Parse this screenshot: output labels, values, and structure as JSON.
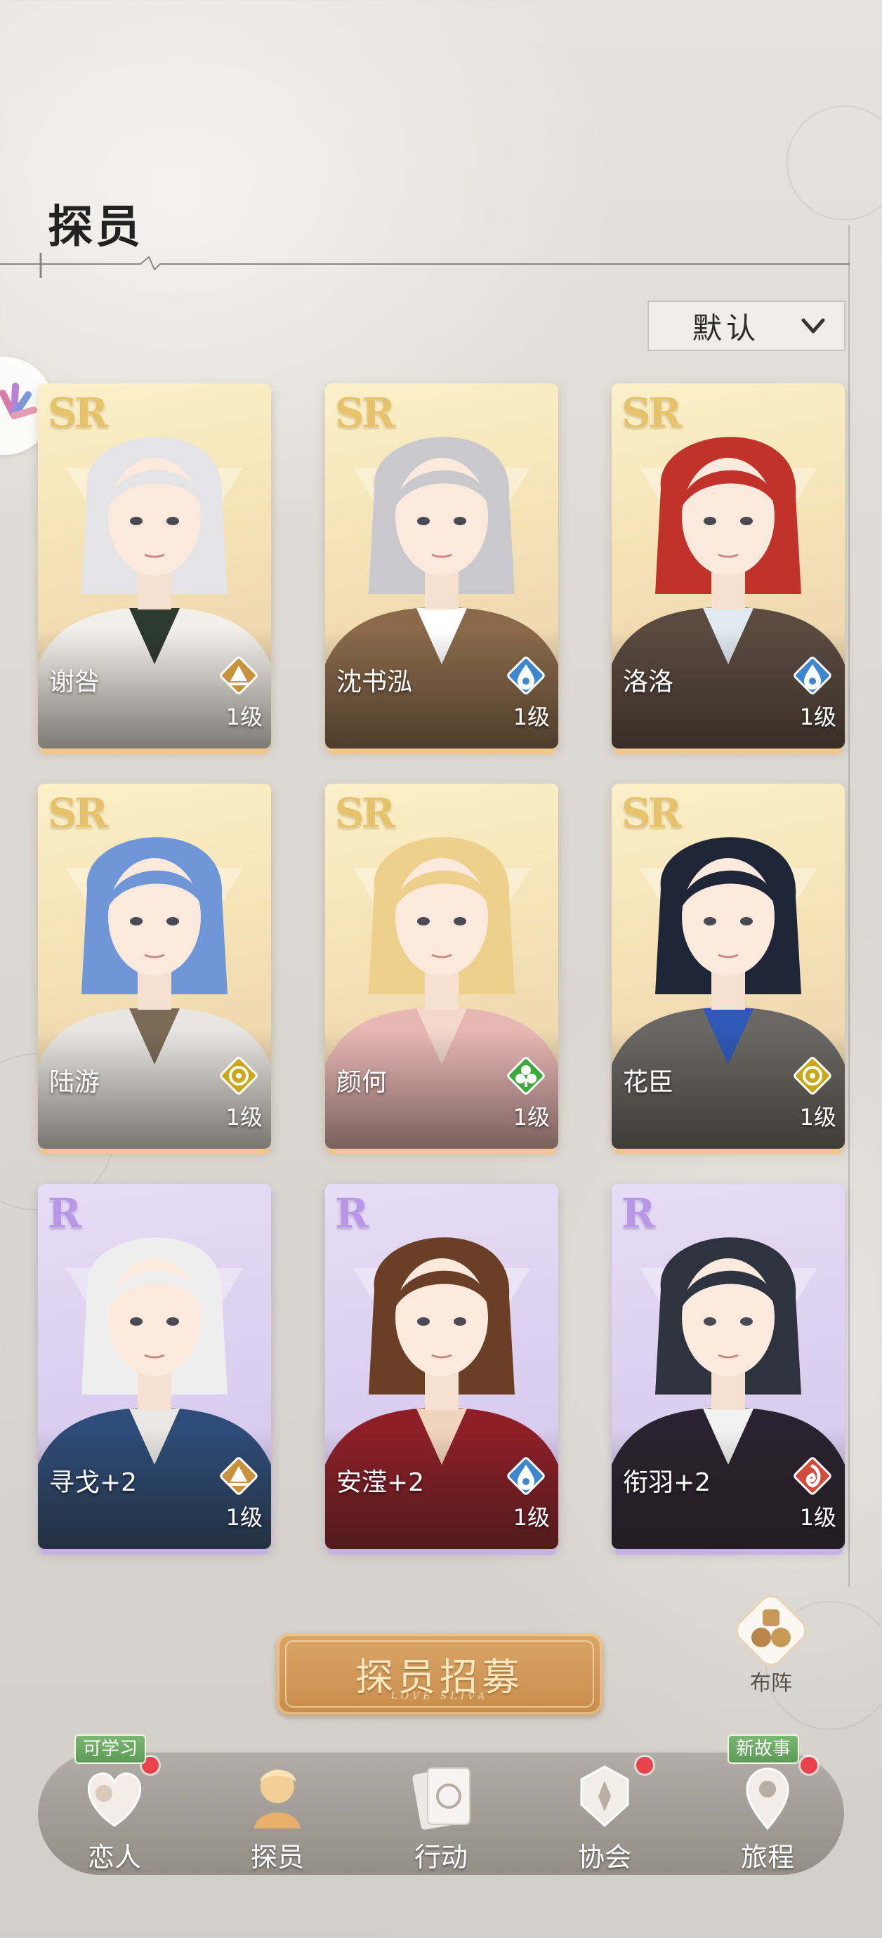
{
  "header": {
    "title": "探员"
  },
  "sort": {
    "label": "默认"
  },
  "cards": [
    {
      "name": "谢咎",
      "level": "1级",
      "rarity": "SR",
      "element": "gold",
      "hair": "#e4e4e6",
      "outfit": "#f2efe8",
      "accent": "#2d3a2e"
    },
    {
      "name": "沈书泓",
      "level": "1级",
      "rarity": "SR",
      "element": "blue",
      "hair": "#c9c9cd",
      "outfit": "#8a6a4a",
      "accent": "#ffffff"
    },
    {
      "name": "洛洛",
      "level": "1级",
      "rarity": "SR",
      "element": "blue",
      "hair": "#c0322a",
      "outfit": "#5a4a40",
      "accent": "#e0e8f0"
    },
    {
      "name": "陆游",
      "level": "1级",
      "rarity": "SR",
      "element": "yellow",
      "hair": "#6f97d8",
      "outfit": "#e8e6e2",
      "accent": "#7a6a56"
    },
    {
      "name": "颜何",
      "level": "1级",
      "rarity": "SR",
      "element": "green",
      "hair": "#ecd08c",
      "outfit": "#e8b7b5",
      "accent": "#f3d8cc"
    },
    {
      "name": "花臣",
      "level": "1级",
      "rarity": "SR",
      "element": "yellow",
      "hair": "#1f2638",
      "outfit": "#6a6864",
      "accent": "#2f58b8"
    },
    {
      "name": "寻戈+2",
      "level": "1级",
      "rarity": "R",
      "element": "gold",
      "hair": "#eeeeef",
      "outfit": "#2d4c78",
      "accent": "#e9e7e4"
    },
    {
      "name": "安滢+2",
      "level": "1级",
      "rarity": "R",
      "element": "blue",
      "hair": "#6b3e26",
      "outfit": "#8e1f28",
      "accent": "#f2d3be"
    },
    {
      "name": "衔羽+2",
      "level": "1级",
      "rarity": "R",
      "element": "red",
      "hair": "#2e3340",
      "outfit": "#2a2230",
      "accent": "#f2f2f2"
    }
  ],
  "recruit": {
    "label": "探员招募",
    "subtitle": "LOVE SLIVA"
  },
  "formation": {
    "label": "布阵"
  },
  "nav": [
    {
      "label": "恋人",
      "badge": "可学习",
      "dot": true
    },
    {
      "label": "探员",
      "badge": "",
      "dot": false
    },
    {
      "label": "行动",
      "badge": "",
      "dot": false
    },
    {
      "label": "协会",
      "badge": "",
      "dot": true
    },
    {
      "label": "旅程",
      "badge": "新故事",
      "dot": true
    }
  ],
  "colors": {
    "sr_frame": "#f5e3b6",
    "r_frame": "#ddd0f0",
    "element_gold": "#c8923c",
    "element_blue": "#3d86d0",
    "element_yellow": "#c9a81a",
    "element_green": "#3caa3a",
    "element_red": "#d24a3a",
    "badge_green": "#6aa963",
    "dot_red": "#e8424a"
  }
}
